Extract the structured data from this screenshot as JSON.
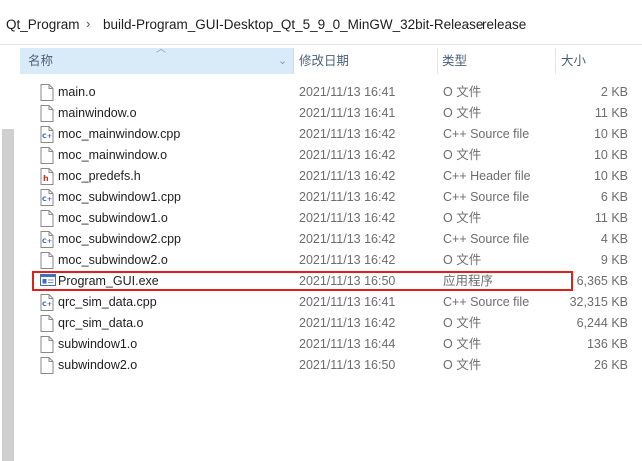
{
  "breadcrumb": {
    "items": [
      "Qt_Program",
      "build-Program_GUI-Desktop_Qt_5_9_0_MinGW_32bit-Release",
      "release"
    ],
    "separator": "›"
  },
  "header": {
    "name": "名称",
    "date": "修改日期",
    "type": "类型",
    "size": "大小"
  },
  "files": [
    {
      "name": "main.o",
      "date": "2021/11/13 16:41",
      "type": "O 文件",
      "size": "2 KB",
      "icon": "generic-file"
    },
    {
      "name": "mainwindow.o",
      "date": "2021/11/13 16:41",
      "type": "O 文件",
      "size": "11 KB",
      "icon": "generic-file"
    },
    {
      "name": "moc_mainwindow.cpp",
      "date": "2021/11/13 16:42",
      "type": "C++ Source file",
      "size": "10 KB",
      "icon": "cpp-file"
    },
    {
      "name": "moc_mainwindow.o",
      "date": "2021/11/13 16:42",
      "type": "O 文件",
      "size": "10 KB",
      "icon": "generic-file"
    },
    {
      "name": "moc_predefs.h",
      "date": "2021/11/13 16:42",
      "type": "C++ Header file",
      "size": "10 KB",
      "icon": "header-file"
    },
    {
      "name": "moc_subwindow1.cpp",
      "date": "2021/11/13 16:42",
      "type": "C++ Source file",
      "size": "6 KB",
      "icon": "cpp-file"
    },
    {
      "name": "moc_subwindow1.o",
      "date": "2021/11/13 16:42",
      "type": "O 文件",
      "size": "11 KB",
      "icon": "generic-file"
    },
    {
      "name": "moc_subwindow2.cpp",
      "date": "2021/11/13 16:42",
      "type": "C++ Source file",
      "size": "4 KB",
      "icon": "cpp-file"
    },
    {
      "name": "moc_subwindow2.o",
      "date": "2021/11/13 16:42",
      "type": "O 文件",
      "size": "9 KB",
      "icon": "generic-file"
    },
    {
      "name": "Program_GUI.exe",
      "date": "2021/11/13 16:50",
      "type": "应用程序",
      "size": "6,365 KB",
      "icon": "exe-file"
    },
    {
      "name": "qrc_sim_data.cpp",
      "date": "2021/11/13 16:41",
      "type": "C++ Source file",
      "size": "32,315 KB",
      "icon": "cpp-file"
    },
    {
      "name": "qrc_sim_data.o",
      "date": "2021/11/13 16:42",
      "type": "O 文件",
      "size": "6,244 KB",
      "icon": "generic-file"
    },
    {
      "name": "subwindow1.o",
      "date": "2021/11/13 16:44",
      "type": "O 文件",
      "size": "136 KB",
      "icon": "generic-file"
    },
    {
      "name": "subwindow2.o",
      "date": "2021/11/13 16:50",
      "type": "O 文件",
      "size": "26 KB",
      "icon": "generic-file"
    }
  ],
  "colors": {
    "highlight_border": "#e0201a",
    "header_selected": "#d9ebf9",
    "header_text": "#4c607a",
    "cpp_icon": "#2f66c8",
    "header_icon": "#c0392b"
  }
}
